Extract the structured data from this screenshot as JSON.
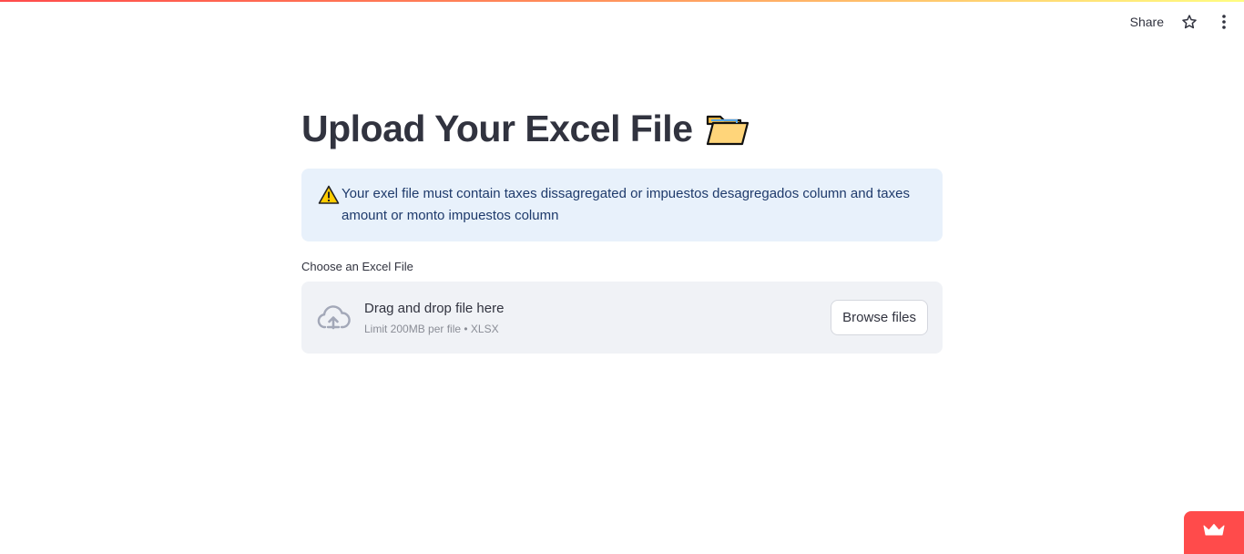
{
  "header": {
    "share_label": "Share",
    "star_icon": "star-icon",
    "menu_icon": "kebab-menu-icon"
  },
  "main": {
    "title": "Upload Your Excel File",
    "title_emoji": "folder-icon",
    "alert": {
      "icon": "warning-icon",
      "text": "Your exel file must contain taxes dissagregated or impuestos desagregados column and taxes amount or monto impuestos column"
    },
    "uploader": {
      "label": "Choose an Excel File",
      "instructions": "Drag and drop file here",
      "limit": "Limit 200MB per file • XLSX",
      "button_label": "Browse files",
      "icon": "cloud-upload-icon"
    }
  },
  "badge": {
    "icon": "crown-icon"
  },
  "colors": {
    "accent": "#ff4b4b",
    "alert_bg": "#e8f1fb",
    "alert_text": "#1e3a6b",
    "dropzone_bg": "#f0f2f6",
    "text": "#31333f"
  }
}
